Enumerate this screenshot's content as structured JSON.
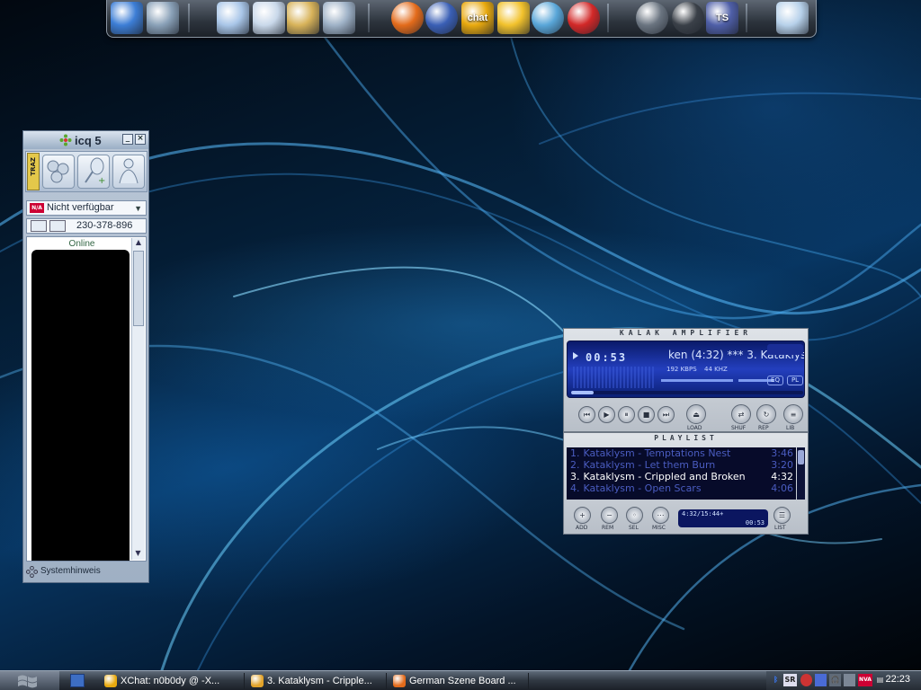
{
  "dock": {
    "icons": [
      {
        "name": "my-computer-icon",
        "color": "#3d7ed6"
      },
      {
        "name": "network-places-icon",
        "color": "#8aa1b8"
      },
      {
        "name": "documents-folder-icon",
        "color": "#a9c6e8"
      },
      {
        "name": "files-folder-icon",
        "color": "#c9d8ea"
      },
      {
        "name": "music-folder-icon",
        "color": "#d8b35a"
      },
      {
        "name": "programs-folder-icon",
        "color": "#9fb2c7"
      },
      {
        "name": "firefox-icon",
        "color": "#e36b1b"
      },
      {
        "name": "thunderbird-icon",
        "color": "#3a5fb5"
      },
      {
        "name": "xchat-icon",
        "color": "#e8a90e",
        "label": "chat"
      },
      {
        "name": "xchat-x-icon",
        "color": "#f2c22c"
      },
      {
        "name": "soulseek-icon",
        "color": "#59a6d8"
      },
      {
        "name": "half-life-icon",
        "color": "#d22828"
      },
      {
        "name": "counter-strike-icon",
        "color": "#6a7480"
      },
      {
        "name": "steam-icon",
        "color": "#3a4048"
      },
      {
        "name": "teamspeak-icon",
        "color": "#4f5fa8",
        "label": "TS"
      },
      {
        "name": "recycle-bin-icon",
        "color": "#b7d1ea"
      }
    ]
  },
  "icq": {
    "title": "icq 5",
    "status": "Nicht verfügbar",
    "uin": "230-378-896",
    "group_label": "Online",
    "footer": "Systemhinweis",
    "side_tab": "TRAZ"
  },
  "amp": {
    "title": "KALAK AMPLIFIER",
    "time": "00:53",
    "marquee": "ken (4:32) *** 3. Kataklys",
    "kbps": "192 KBPS",
    "khz": "44 KHZ",
    "eq": "EQ",
    "pl": "PL",
    "load_label": "LOAD",
    "shuf_label": "SHUF",
    "rep_label": "REP",
    "lib_label": "LIB"
  },
  "playlist": {
    "title": "PLAYLIST",
    "items": [
      {
        "num": "1.",
        "title": "Kataklysm - Temptations Nest",
        "length": "3:46",
        "active": false
      },
      {
        "num": "2.",
        "title": "Kataklysm - Let them Burn",
        "length": "3:20",
        "active": false
      },
      {
        "num": "3.",
        "title": "Kataklysm - Crippled and Broken",
        "length": "4:32",
        "active": true
      },
      {
        "num": "4.",
        "title": "Kataklysm - Open Scars",
        "length": "4:06",
        "active": false
      }
    ],
    "total": "4:32/15:44+",
    "elapsed": "00:53",
    "buttons": {
      "add": "ADD",
      "rem": "REM",
      "sel": "SEL",
      "misc": "MISC",
      "list": "LIST"
    }
  },
  "taskbar": {
    "tasks": [
      {
        "label": "XChat: n0b0dy @ -X...",
        "icon_color": "#e8a90e"
      },
      {
        "label": "3. Kataklysm - Cripple...",
        "icon_color": "#e2a32a"
      },
      {
        "label": "German Szene Board ...",
        "icon_color": "#e36b1b"
      }
    ],
    "tray_labels": {
      "sr": "SR",
      "nva": "NVA"
    },
    "clock": "22:23"
  }
}
